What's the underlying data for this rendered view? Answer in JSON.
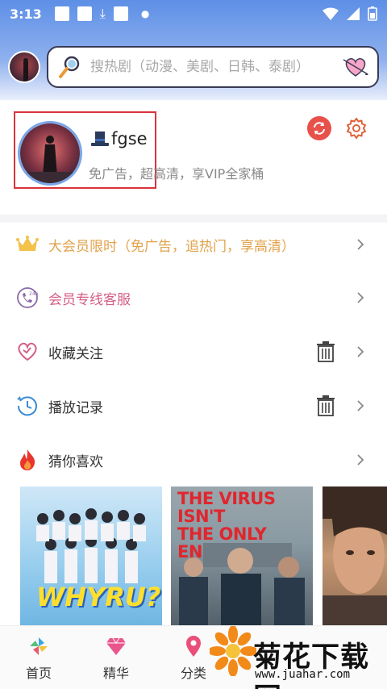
{
  "status_bar": {
    "time": "3:13"
  },
  "search": {
    "placeholder": "搜热剧（动漫、美剧、日韩、泰剧）"
  },
  "profile": {
    "username": "fgse",
    "subtitle": "免广告，超高清，享VIP全家桶"
  },
  "menu": {
    "vip_promo": "大会员限时（免广告，追热门，享高清）",
    "vip_service": "会员专线客服",
    "favorites": "收藏关注",
    "history": "播放记录",
    "recommend": "猜你喜欢"
  },
  "posters": {
    "p1_title": "WHYRU?",
    "p2_title_line1": "THE VIRUS ISN'T",
    "p2_title_line2": "THE ONLY ENEMY"
  },
  "tabs": [
    {
      "label": "首页",
      "icon": "pinwheel-icon"
    },
    {
      "label": "精华",
      "icon": "gem-icon"
    },
    {
      "label": "分类",
      "icon": "map-pin-icon"
    }
  ],
  "watermark": {
    "brand": "菊花下载网",
    "url": "www.juahar.com"
  },
  "colors": {
    "header_blue": "#5d8fe6",
    "vip_gold": "#e0a24a",
    "pink": "#d45e87",
    "highlight_red": "#d9333b"
  }
}
